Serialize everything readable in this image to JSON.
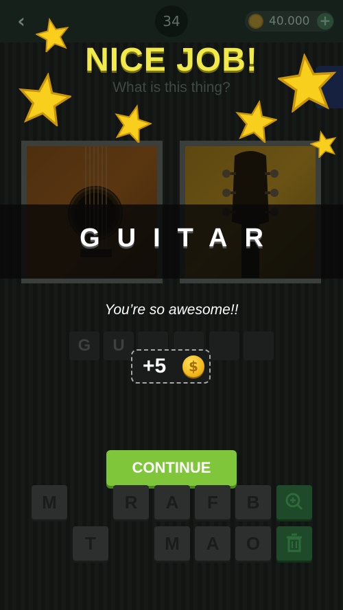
{
  "topbar": {
    "back_icon": "chevron-left-icon",
    "level": "34",
    "coins": "40.000",
    "plus_icon": "plus-icon"
  },
  "popup": {
    "title": "NICE JOB!",
    "question": "What is this thing?",
    "answer": "GUITAR",
    "praise": "You’re so awesome!!",
    "reward": "+5",
    "coin_symbol": "$",
    "continue_label": "CONTINUE"
  },
  "answer_slots": [
    "G",
    "U",
    "",
    "",
    "",
    ""
  ],
  "keyboard": {
    "row1": [
      "M",
      "",
      "R",
      "A",
      "F",
      "B"
    ],
    "row2": [
      "T",
      "",
      "M",
      "A",
      "O"
    ],
    "hint_icon": "magnifier-plus-icon",
    "delete_icon": "trash-icon"
  },
  "colors": {
    "title": "#f2ea4a",
    "continue": "#7fc63a",
    "star": "#f7cf1c"
  }
}
